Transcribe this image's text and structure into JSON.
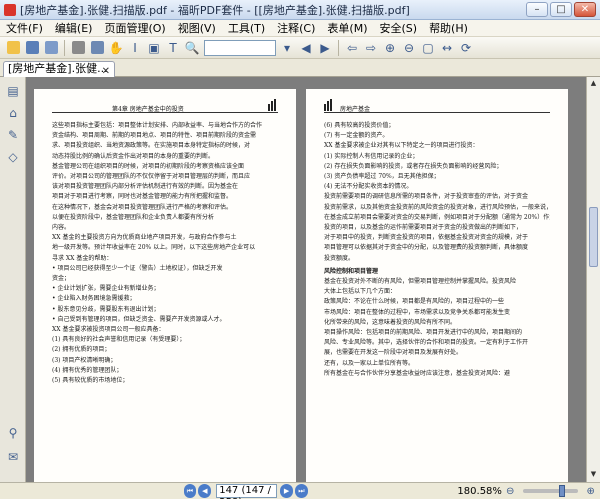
{
  "window": {
    "title": "[房地产基金].张健.扫描版.pdf - 福昕PDF套件 - [[房地产基金].张健.扫描版.pdf]",
    "tab_label": "[房地产基金].张健..."
  },
  "menu": [
    "文件(F)",
    "编辑(E)",
    "页面管理(O)",
    "视图(V)",
    "工具(T)",
    "注释(C)",
    "表单(M)",
    "安全(S)",
    "帮助(H)"
  ],
  "toolbar": {
    "icons": [
      "open-folder-icon",
      "save-icon",
      "save-as-icon",
      "print-icon",
      "scan-icon",
      "hand-tool-icon",
      "select-text-icon",
      "snapshot-icon",
      "typewriter-icon",
      "search-icon",
      "find-icon",
      "prev-page-icon",
      "next-page-icon",
      "back-icon",
      "forward-icon",
      "zoom-in-icon",
      "zoom-out-icon",
      "fit-page-icon",
      "fit-width-icon",
      "rotate-icon"
    ]
  },
  "page_left": {
    "header": "第4章  房地产基金中的投资",
    "lines": [
      "这些项目指标主要包括：项目整体计划安排、内部收益率、与当地合作方的合作",
      "资金结构、项目周期、前期的项目地点、项目的特性、项目前期阶段的资金需",
      "求、项目投资组织、当地资源政策等。在实施项目本身特定指标的时候，对",
      "动态持股比例的确认后资金作出对项目的本身的重要的判断。",
      "基金管理公司在组织项目的时候，对项目的初期阶段的考察资格应该全面",
      "评价。对项目公司的管理团队的不仅仅停留于对项目管理层的判断，而且应",
      "该对项目投资管理团队内部分析评估机制进行有效的判断。因为基金在",
      "项目对于项目进行考察，同时也对基金管理的能力有所把握和监督。",
      "在这种情况下，基金会对项目投资管理团队进行严格的考察和评估。",
      "以便在投资阶段中，基金管理团队和企业负责人都要有所分析",
      "内容。",
      "XX 基金的主要投资方向为优质商业地产项目开发，与政府合作参与土",
      "地一级开发等。预计年收益率在 20% 以上。同时，以下这些房地产企业可以",
      "寻求 XX 基金的帮助：",
      "• 项目公司已经获得至少一个证（警告）土地权证），但缺乏开发",
      "  资金；",
      "• 企业计划扩张，需要企业有新增业务；",
      "• 企业陷入财务困境急需援救；",
      "• 股东意见分歧，需要股东有退出计划；",
      "• 自己受到有管理的项目，但缺乏资金、需要产开发资源或人才。",
      "XX 基金要求被投资项目公司一般应具备：",
      "(1) 具有良好的社会声誉和信用记录（有受理要）；",
      "(2) 拥有优质的项目；",
      "(3) 项目产权清晰明确；",
      "(4) 拥有优秀的管理团队；",
      "(5) 具有较优质的市场地位；"
    ],
    "page_number": "129"
  },
  "page_right": {
    "header": "房地产基金",
    "lines": [
      "(6) 具有较高的投资价值；",
      "(7) 有一定金额的资产。",
      "XX 基金要求被企业对其有以下特定之一的项目进行投资：",
      "(1) 实际控制人有信用记录的企业；",
      "(2) 存在损失负面影响的投资，或者存在损失负面影响的经营风险；",
      "(3) 资产负债率超过 70%，且无其他担保；",
      "(4) 无法不分配实收资本的情况。",
      "投资前需要项目的调研信息所需的项目条件，对于投资审查的评估，对于资金",
      "投资前需求，以及其他资金投资前的风险资金的投资对象，进行风险预估，一般来说，",
      "在基金成立前项目会需要对资金的交易判断，例如项目对于分配额（通常为 20%）作为",
      "投资的项目，以及基金的运作前需要项目对于资金的投资做出的判断如下，",
      "对于项目中的投资，判断资金投资的项目，依据基金投资对资金的规模，对于",
      "项目管理可以依据其对于资金中的分配，以及管理费的投资额判断，具体额度",
      "投资额度。",
      "风险控制和项目管理",
      "基金在投资对外不断的有风险，但需项目管理控制并掌握风险。投资风险",
      "大体上包括以下几个方面：",
      "政策风险：不论在什么时候，项目都是有风险的，项目过程中的一些",
      "市场风险：项目在整体的过程中，市场需求以及竞争关系都可能发生变",
      "化所带来的风险，这意味着投资的风险有所不同。",
      "项目操作风险：包括项目的前期风险、项目开发进行中的风险，项目期间的",
      "风险、专业风险等。其中，选择伙伴的合作和项目的投资。一定有利于工作开",
      "展，也需要在开发这一阶段中对项目及发展有好处。",
      "还有，以及一家以上单位所有等。",
      "所有基金在与合作伙伴分享基金收益时应该注意，基金投资对风险：避"
    ],
    "page_number": "130"
  },
  "status": {
    "page_indicator": "147 (147 / 258)",
    "zoom": "180.58%"
  }
}
